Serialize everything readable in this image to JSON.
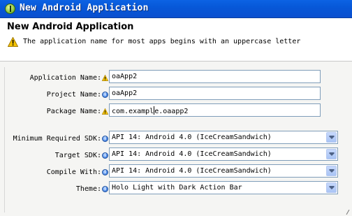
{
  "window": {
    "title": "New Android Application",
    "logo_icon": "android-adt-icon"
  },
  "header": {
    "title": "New Android Application",
    "message": "The application name for most apps begins with an uppercase letter",
    "message_icon": "warning-icon"
  },
  "form": {
    "application_name": {
      "label": "Application Name:",
      "value": "oaApp2",
      "decoration": "warning-icon"
    },
    "project_name": {
      "label": "Project Name:",
      "value": "oaApp2",
      "decoration": "info-icon"
    },
    "package_name": {
      "label": "Package Name:",
      "value_before_caret": "com.exampl",
      "value_after_caret": "e.oaapp2",
      "decoration": "warning-icon"
    },
    "min_sdk": {
      "label": "Minimum Required SDK:",
      "selected": "API 14: Android 4.0 (IceCreamSandwich)",
      "decoration": "info-icon"
    },
    "target_sdk": {
      "label": "Target SDK:",
      "selected": "API 14: Android 4.0 (IceCreamSandwich)",
      "decoration": "info-icon"
    },
    "compile_with": {
      "label": "Compile With:",
      "selected": "API 14: Android 4.0 (IceCreamSandwich)",
      "decoration": "info-icon"
    },
    "theme": {
      "label": "Theme:",
      "selected": "Holo Light with Dark Action Bar",
      "decoration": "info-icon"
    }
  },
  "colors": {
    "titlebar": "#0a5ddc",
    "warning": "#f2c200",
    "info": "#2b6fd6",
    "field_border": "#7f9db9"
  }
}
